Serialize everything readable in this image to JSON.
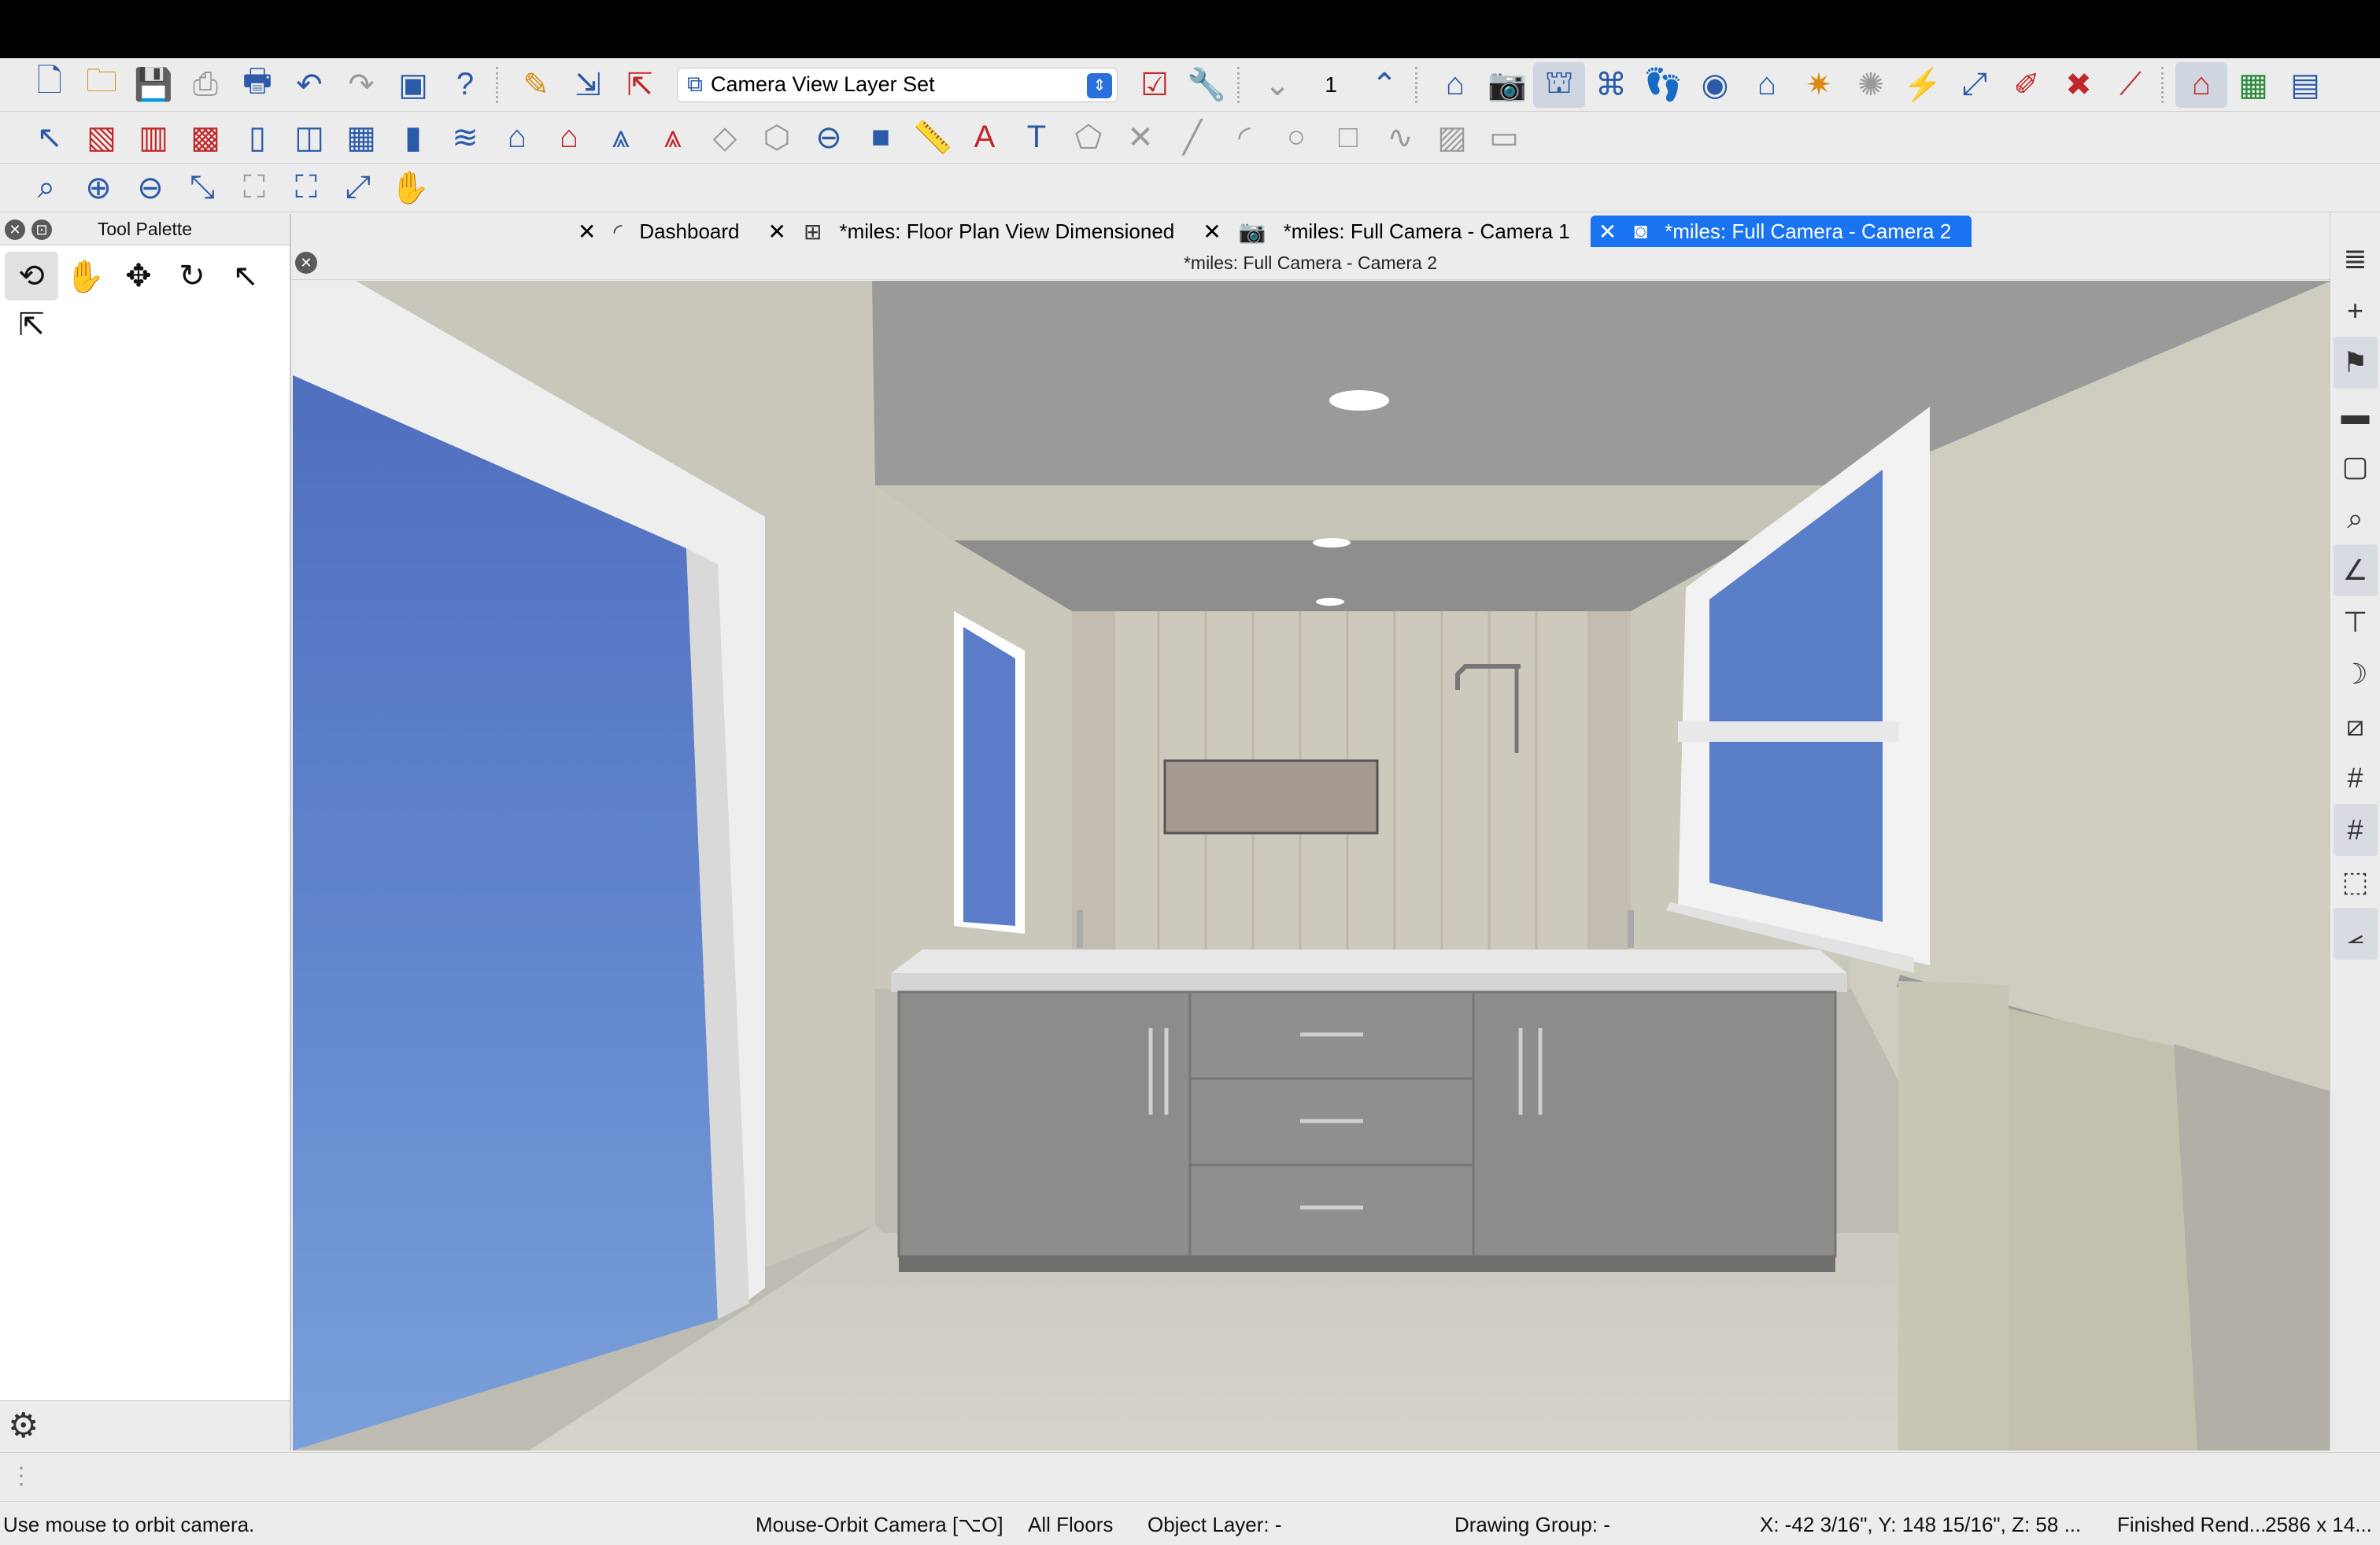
{
  "toolbar1": {
    "layer_set": "Camera View Layer Set",
    "floor_number": "1"
  },
  "palette": {
    "title": "Tool Palette"
  },
  "tabs": [
    {
      "label": "Dashboard"
    },
    {
      "label": "*miles: Floor Plan View Dimensioned"
    },
    {
      "label": "*miles: Full Camera - Camera 1"
    },
    {
      "label": "*miles: Full Camera - Camera 2"
    }
  ],
  "view": {
    "title": "*miles: Full Camera - Camera 2"
  },
  "status": {
    "hint": "Use mouse to orbit camera.",
    "mode": "Mouse-Orbit Camera [⌥O]",
    "floors": "All Floors",
    "object_layer": "Object Layer: -",
    "drawing_group": "Drawing Group: -",
    "coords": "X: -42 3/16\", Y: 148 15/16\", Z: 58 ...",
    "render": "Finished Rend...",
    "size": "2586 x 14..."
  },
  "icons": {
    "toolbar1": [
      "new-file-icon",
      "open-folder-icon",
      "save-icon",
      "print-icon",
      "print-preview-icon",
      "undo-icon",
      "redo-icon",
      "layout-icon",
      "help-icon",
      "edit-layer-icon",
      "send-to-layout-icon",
      "export-icon",
      "layer-set-icon",
      "checklist-icon",
      "wrench-icon",
      "floor-down-icon",
      "floor-up-icon",
      "home-icon",
      "camera-icon",
      "elevation-icon",
      "overview-icon",
      "walkthrough-icon",
      "orbit-icon",
      "doll-house-icon",
      "light-icon",
      "sun-icon",
      "electrical-icon",
      "measure-icon",
      "texture-icon",
      "delete-icon",
      "ruler-icon",
      "house-view-icon",
      "image-icon",
      "window-icon"
    ],
    "toolbar2": [
      "select-icon",
      "wall-icon",
      "railing-icon",
      "cabinet-icon",
      "door-icon",
      "window-tool-icon",
      "fixture-icon",
      "shelf-icon",
      "stair-icon",
      "roof-icon",
      "house-red-icon",
      "dormer-icon",
      "fence-icon",
      "slab-icon",
      "terrain-icon",
      "ceiling-icon",
      "box-icon",
      "ruler-tool-icon",
      "text-arrow-icon",
      "text-icon",
      "polyline-icon",
      "cross-icon",
      "line-icon",
      "arc-icon",
      "circle-icon",
      "rectangle-icon",
      "spline-icon",
      "picture-icon",
      "cad-block-icon"
    ],
    "toolbar3": [
      "zoom-window-icon",
      "zoom-in-icon",
      "zoom-out-icon",
      "undo-zoom-icon",
      "fill-window-icon",
      "fill-window-all-icon",
      "fit-page-icon",
      "pan-icon"
    ]
  }
}
